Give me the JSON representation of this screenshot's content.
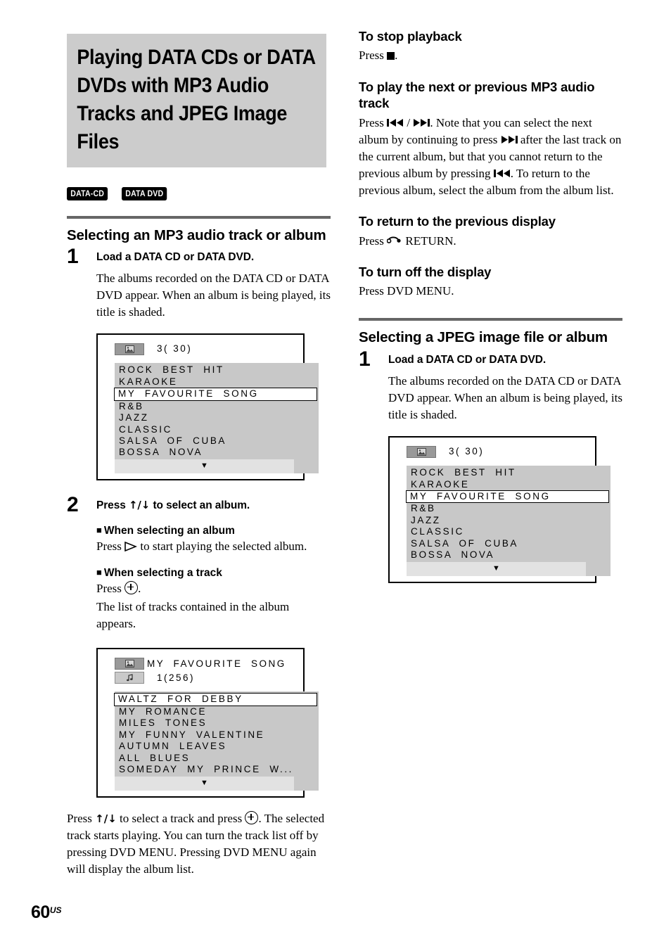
{
  "page": {
    "number": "60",
    "region_suffix": "US"
  },
  "chapter": {
    "title": "Playing DATA CDs or DATA DVDs with MP3 Audio Tracks and JPEG Image Files",
    "badges": [
      "DATA-CD",
      "DATA DVD"
    ]
  },
  "left_column": {
    "section": {
      "heading": "Selecting an MP3 audio track or album"
    },
    "step1": {
      "number": "1",
      "title": "Load a DATA CD or DATA DVD.",
      "body": "The albums recorded on the DATA CD or DATA DVD appear. When an album is being played, its title is shaded."
    },
    "album_screen": {
      "icon": "album-image-icon",
      "count": "3( 30)",
      "rows": [
        "ROCK  BEST  HIT",
        "KARAOKE",
        "MY  FAVOURITE  SONG",
        "R&B",
        "JAZZ",
        "CLASSIC",
        "SALSA  OF  CUBA",
        "BOSSA  NOVA"
      ],
      "selected_index": 2,
      "scroll_marker": "▼"
    },
    "step2": {
      "number": "2",
      "title_before": "Press ",
      "title_arrows": "↑/↓",
      "title_after": " to select an album.",
      "sub1_heading": "When selecting an album",
      "sub1_text_before": "Press ",
      "sub1_text_after": " to start playing the selected album.",
      "sub2_heading": "When selecting a track",
      "sub2_text_before": "Press ",
      "sub2_text_after": ".",
      "sub2_note": "The list of tracks contained in the album appears."
    },
    "track_screen": {
      "icon_album": "album-image-icon",
      "icon_track": "music-note-icon",
      "title": "MY  FAVOURITE  SONG",
      "count": "1(256)",
      "rows": [
        "WALTZ  FOR  DEBBY",
        "MY  ROMANCE",
        "MILES  TONES",
        "MY  FUNNY  VALENTINE",
        "AUTUMN  LEAVES",
        "ALL  BLUES",
        "SOMEDAY  MY  PRINCE  W..."
      ],
      "selected_index": 0,
      "scroll_marker": "▼"
    },
    "closing": {
      "before_arrows": "Press ",
      "arrows": "↑/↓",
      "mid": " to select a track and press ",
      "after": ". The selected track starts playing. You can turn the track list off by pressing DVD MENU. Pressing DVD MENU again will display the album list."
    }
  },
  "right_column": {
    "stop": {
      "heading": "To stop playback",
      "text_before": "Press ",
      "text_after": "."
    },
    "next_prev": {
      "heading": "To play the next or previous MP3 audio track",
      "t1": "Press ",
      "t2": " / ",
      "t3": ". Note that you can select the next album by continuing to press ",
      "t4": " after the last track on the current album, but that you cannot return to the previous album by pressing ",
      "t5": ". To return to the previous album, select the album from the album list."
    },
    "previous_display": {
      "heading": "To return to the previous display",
      "text_before": "Press ",
      "text_after": " RETURN."
    },
    "turn_off": {
      "heading": "To turn off the display",
      "text": "Press DVD MENU."
    },
    "jpeg_section": {
      "heading": "Selecting a JPEG image file or album",
      "step1": {
        "number": "1",
        "title": "Load a DATA CD or DATA DVD.",
        "body": "The albums recorded on the DATA CD or DATA DVD appear. When an album is being played, its title is shaded."
      },
      "album_screen": {
        "icon": "album-image-icon",
        "count": "3( 30)",
        "rows": [
          "ROCK  BEST  HIT",
          "KARAOKE",
          "MY  FAVOURITE  SONG",
          "R&B",
          "JAZZ",
          "CLASSIC",
          "SALSA  OF  CUBA",
          "BOSSA  NOVA"
        ],
        "selected_index": 2,
        "scroll_marker": "▼"
      }
    }
  },
  "colors": {
    "title_background": "#cccccc",
    "rule": "#666666",
    "list_shade": "#c8c8c8",
    "scroll_shade": "#e2e2e2",
    "icon_badge": "#999999"
  }
}
